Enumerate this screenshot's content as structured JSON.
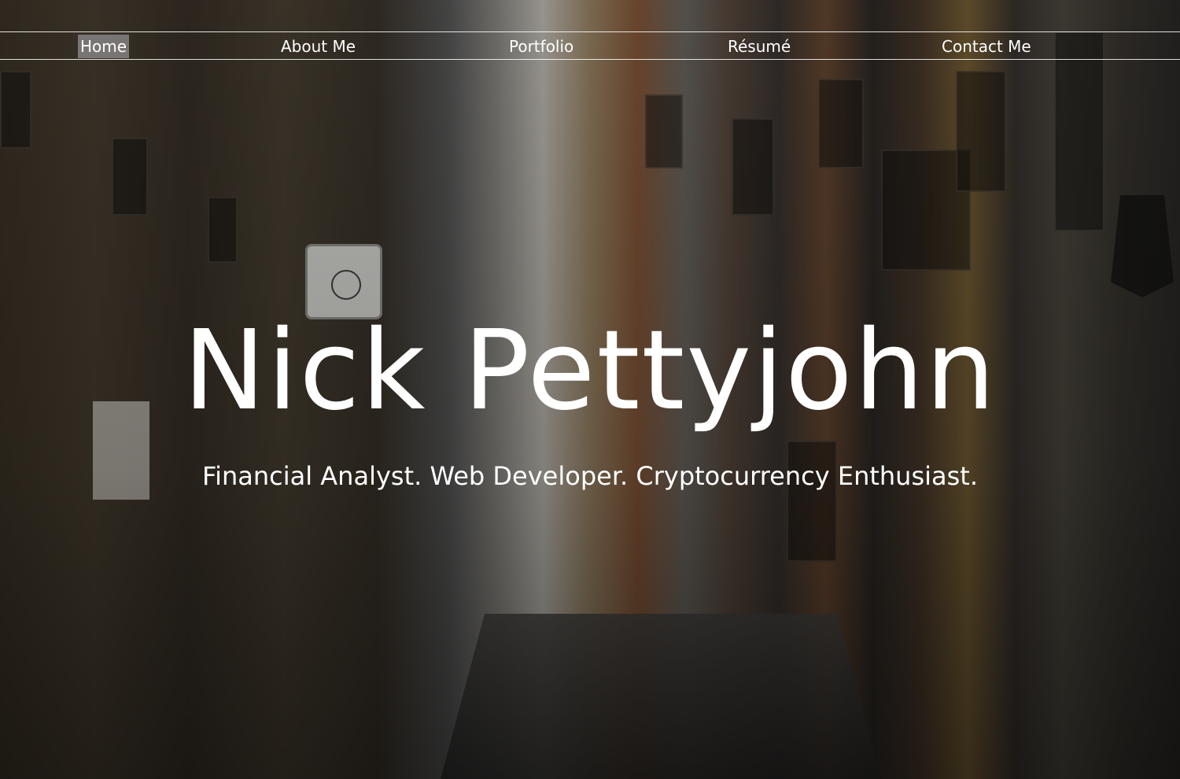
{
  "nav": {
    "items": [
      {
        "label": "Home",
        "active": true
      },
      {
        "label": "About Me",
        "active": false
      },
      {
        "label": "Portfolio",
        "active": false
      },
      {
        "label": "Résumé",
        "active": false
      },
      {
        "label": "Contact Me",
        "active": false
      }
    ]
  },
  "hero": {
    "name": "Nick Pettyjohn",
    "tagline": "Financial Analyst. Web Developer. Cryptocurrency Enthusiast."
  },
  "colors": {
    "text": "#ffffff",
    "nav_active_bg": "#828282",
    "nav_rule": "#ffffff"
  }
}
